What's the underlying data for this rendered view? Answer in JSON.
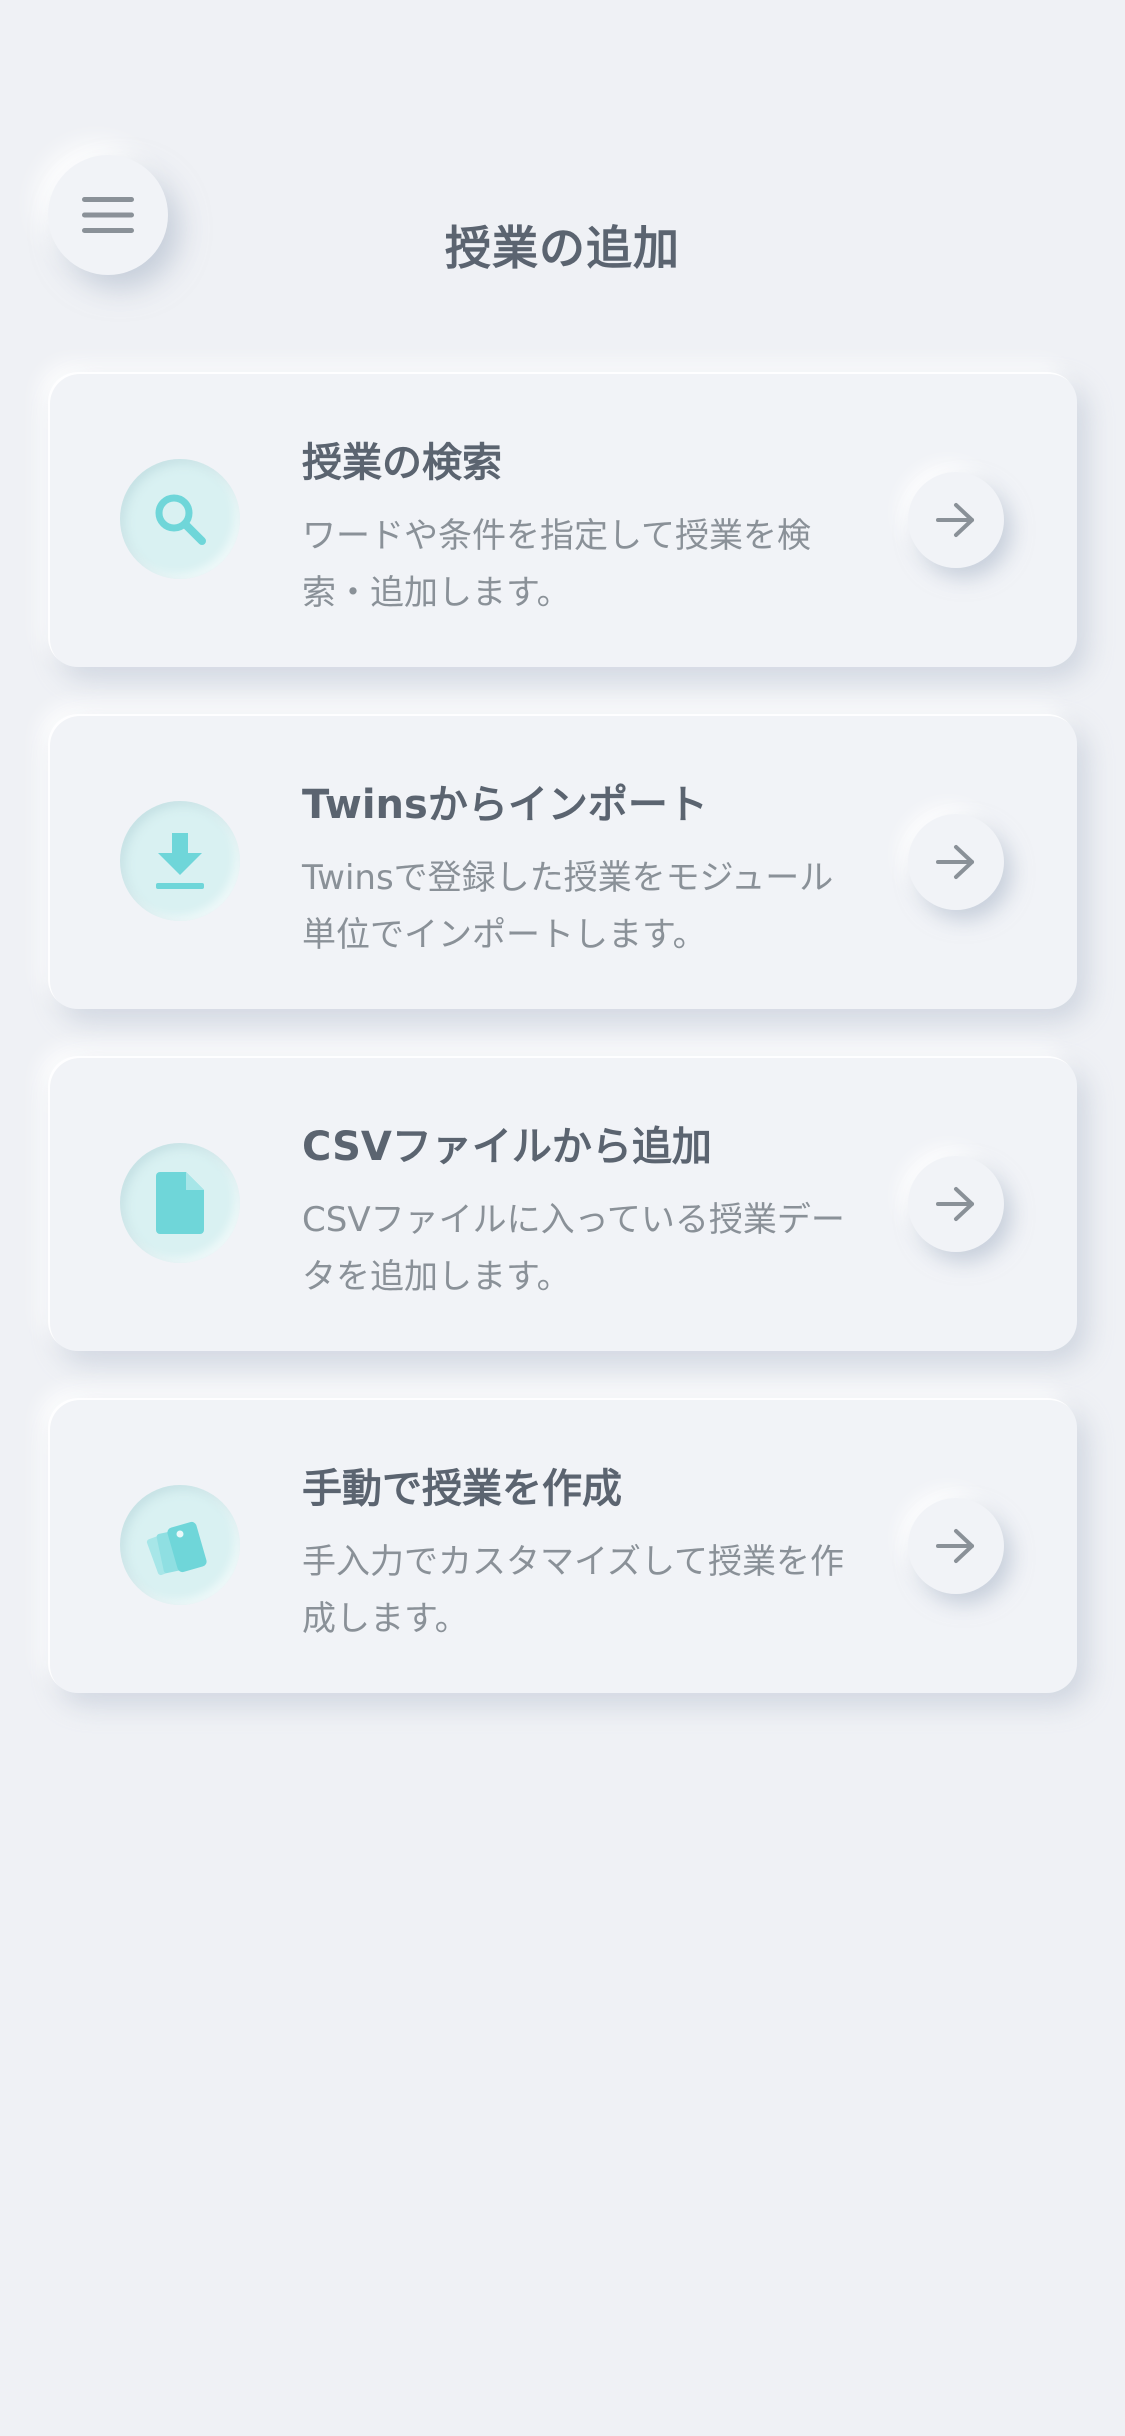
{
  "header": {
    "title": "授業の追加",
    "menu_icon": "hamburger-menu-icon"
  },
  "cards": [
    {
      "icon": "search-icon",
      "title": "授業の検索",
      "description": "ワードや条件を指定して授業を検索・追加します。"
    },
    {
      "icon": "download-icon",
      "title": "Twinsからインポート",
      "description": "Twinsで登録した授業をモジュール単位でインポートします。"
    },
    {
      "icon": "file-icon",
      "title": "CSVファイルから追加",
      "description": "CSVファイルに入っている授業データを追加します。"
    },
    {
      "icon": "swatch-cards-icon",
      "title": "手動で授業を作成",
      "description": "手入力でカスタマイズして授業を作成します。"
    }
  ],
  "colors": {
    "background": "#eff1f5",
    "accent": "#6fd6d9",
    "accent_bg": "#d9f1f2",
    "text_primary": "#5b6470",
    "text_secondary": "#8a9198"
  }
}
